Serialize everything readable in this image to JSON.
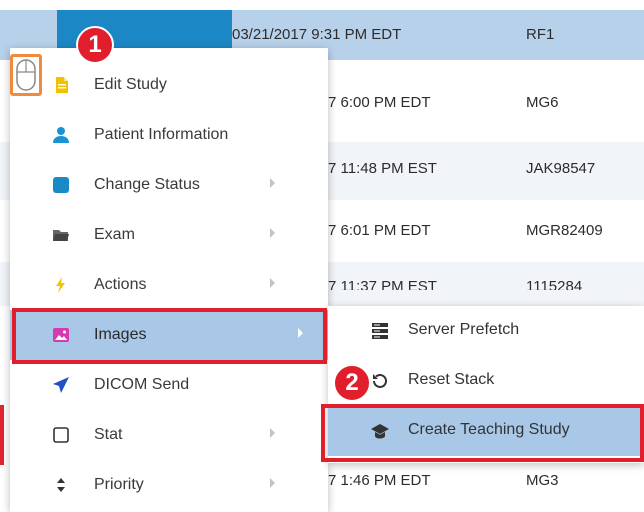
{
  "worklist": {
    "rows": [
      {
        "datetime": "03/21/2017 9:31 PM EDT",
        "id": "RF1"
      },
      {
        "datetime": "7 6:00 PM EDT",
        "id": "MG6"
      },
      {
        "datetime": "7 11:48 PM EST",
        "id": "JAK98547"
      },
      {
        "datetime": "7 6:01 PM EDT",
        "id": "MGR82409"
      },
      {
        "datetime": "7 11:37 PM EST",
        "id": "1115284"
      },
      {
        "datetime": "7 1:46 PM EDT",
        "id": "MG3"
      }
    ]
  },
  "context_menu": {
    "items": [
      {
        "label": "Edit Study",
        "icon": "document-icon"
      },
      {
        "label": "Patient Information",
        "icon": "person-icon"
      },
      {
        "label": "Change Status",
        "icon": "square-icon"
      },
      {
        "label": "Exam",
        "icon": "folder-icon"
      },
      {
        "label": "Actions",
        "icon": "lightning-icon"
      },
      {
        "label": "Images",
        "icon": "image-icon"
      },
      {
        "label": "DICOM Send",
        "icon": "send-icon"
      },
      {
        "label": "Stat",
        "icon": "checkbox-icon"
      },
      {
        "label": "Priority",
        "icon": "sort-icon"
      }
    ]
  },
  "submenu": {
    "items": [
      {
        "label": "Server Prefetch",
        "icon": "server-icon"
      },
      {
        "label": "Reset Stack",
        "icon": "reset-icon"
      },
      {
        "label": "Create Teaching Study",
        "icon": "graduation-cap-icon"
      }
    ]
  },
  "annotations": {
    "step1": "1",
    "step2": "2"
  },
  "colors": {
    "highlight": "#a9c8e8",
    "annotation_red": "#e11f2c",
    "selected_row": "#b8d1ea",
    "selected_cell": "#1b87c4"
  }
}
